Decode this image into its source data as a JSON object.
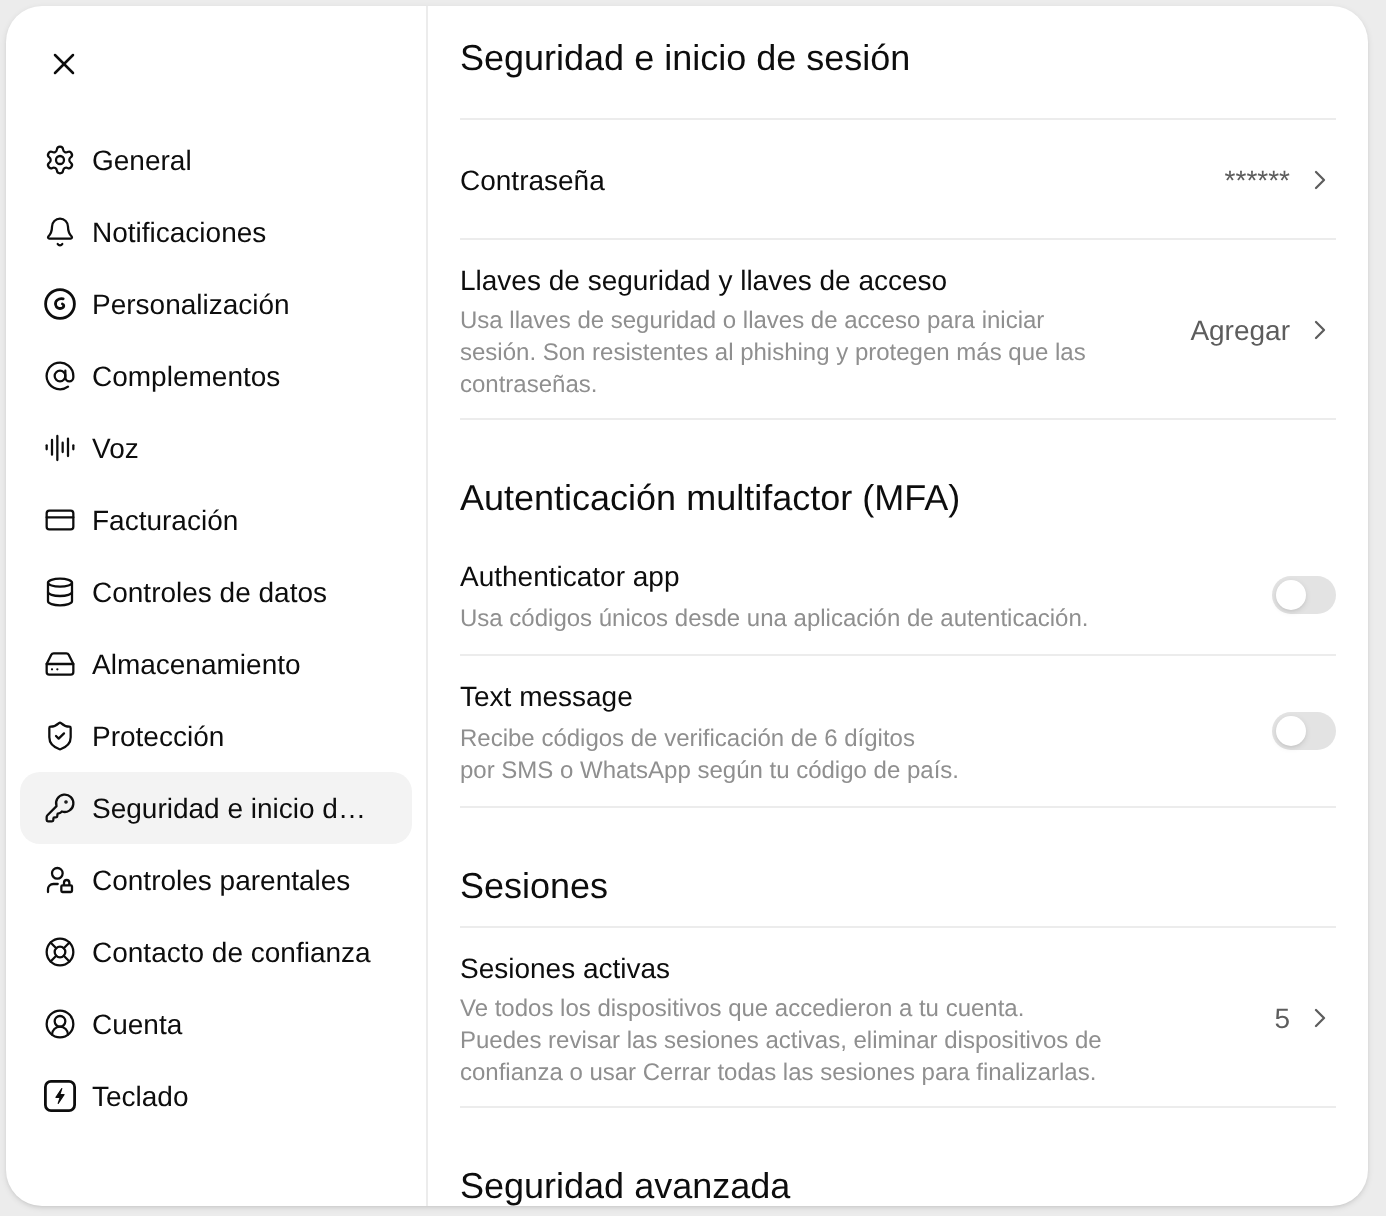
{
  "sidebar": {
    "items": [
      {
        "label": "General",
        "selected": false
      },
      {
        "label": "Notificaciones",
        "selected": false
      },
      {
        "label": "Personalización",
        "selected": false
      },
      {
        "label": "Complementos",
        "selected": false
      },
      {
        "label": "Voz",
        "selected": false
      },
      {
        "label": "Facturación",
        "selected": false
      },
      {
        "label": "Controles de datos",
        "selected": false
      },
      {
        "label": "Almacenamiento",
        "selected": false
      },
      {
        "label": "Protección",
        "selected": false
      },
      {
        "label": "Seguridad e inicio d…",
        "selected": true
      },
      {
        "label": "Controles parentales",
        "selected": false
      },
      {
        "label": "Contacto de confianza",
        "selected": false
      },
      {
        "label": "Cuenta",
        "selected": false
      },
      {
        "label": "Teclado",
        "selected": false
      }
    ]
  },
  "main": {
    "title": "Seguridad e inicio de sesión",
    "rows": [
      {
        "kind": "link",
        "label": "Contraseña",
        "value": "******"
      },
      {
        "kind": "link",
        "label": "Llaves de seguridad y llaves de acceso",
        "description": "Usa llaves de seguridad o llaves de acceso para iniciar\nsesión. Son resistentes al phishing y protegen más que las\ncontraseñas.",
        "value": "Agregar"
      }
    ]
  },
  "sections": [
    {
      "heading": "Autenticación multifactor (MFA)",
      "rows": [
        {
          "kind": "toggle",
          "label": "Authenticator app",
          "description": "Usa códigos únicos desde una aplicación de autenticación.",
          "on": false
        },
        {
          "kind": "toggle",
          "label": "Text message",
          "description": "Recibe códigos de verificación de 6 dígitos\npor SMS o WhatsApp según tu código de país.",
          "on": false
        }
      ]
    },
    {
      "heading": "Sesiones",
      "rows": [
        {
          "kind": "link",
          "label": "Sesiones activas",
          "description": "Ve todos los dispositivos que accedieron a tu cuenta.\nPuedes revisar las sesiones activas, eliminar dispositivos de\nconfianza o usar Cerrar todas las sesiones para finalizarlas.",
          "value": "5"
        }
      ]
    },
    {
      "heading": "Seguridad avanzada"
    }
  ]
}
